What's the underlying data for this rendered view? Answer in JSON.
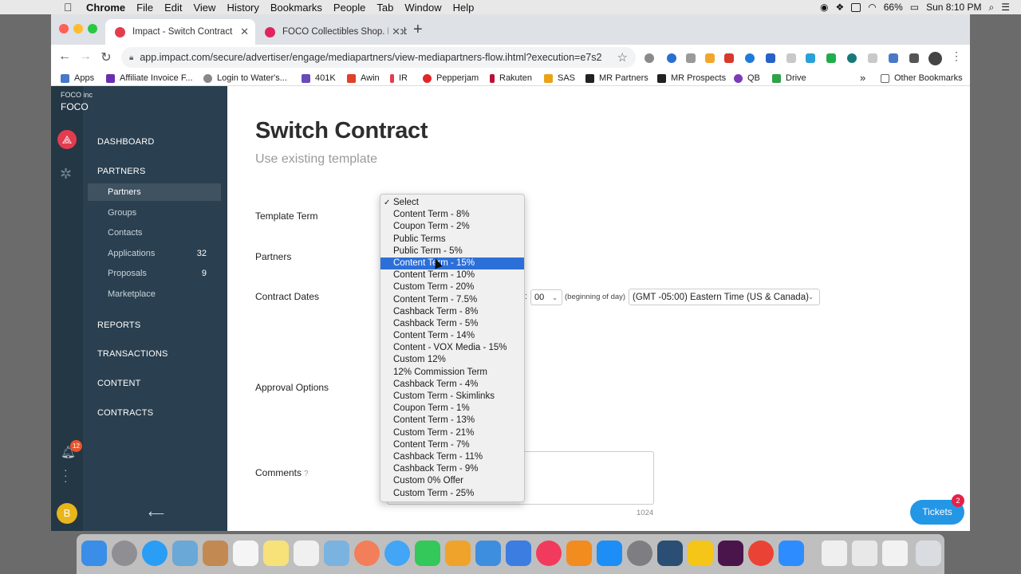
{
  "menubar": {
    "app": "Chrome",
    "items": [
      "File",
      "Edit",
      "View",
      "History",
      "Bookmarks",
      "People",
      "Tab",
      "Window",
      "Help"
    ],
    "battery": "66%",
    "clock": "Sun 8:10 PM"
  },
  "tabs": [
    {
      "title": "Impact - Switch Contract",
      "active": true
    },
    {
      "title": "FOCO Collectibles Shop. Bobb",
      "active": false
    }
  ],
  "address": {
    "url": "app.impact.com/secure/advertiser/engage/mediapartners/view-mediapartners-flow.ihtml?execution=e7s2"
  },
  "bookmarks": {
    "items": [
      "Apps",
      "Affiliate Invoice F...",
      "Login to Water's...",
      "401K",
      "Awin",
      "IR",
      "Pepperjam",
      "Rakuten",
      "SAS",
      "MR Partners",
      "MR Prospects",
      "QB",
      "Drive"
    ],
    "overflow": "»",
    "other": "Other Bookmarks"
  },
  "sidebar": {
    "org_small": "FOCO inc",
    "org_name": "FOCO",
    "dashboard": "DASHBOARD",
    "partners": "PARTNERS",
    "partners_items": [
      {
        "label": "Partners",
        "count": ""
      },
      {
        "label": "Groups",
        "count": ""
      },
      {
        "label": "Contacts",
        "count": ""
      },
      {
        "label": "Applications",
        "count": "32"
      },
      {
        "label": "Proposals",
        "count": "9"
      },
      {
        "label": "Marketplace",
        "count": ""
      }
    ],
    "reports": "REPORTS",
    "transactions": "TRANSACTIONS",
    "content": "CONTENT",
    "contracts": "CONTRACTS",
    "notification_count": "12",
    "avatar_letter": "B",
    "collapse_icon": "⟵"
  },
  "main": {
    "title": "Switch Contract",
    "subtitle": "Use existing template",
    "labels": {
      "template_term": "Template Term",
      "partners": "Partners",
      "contract_dates": "Contract Dates",
      "approval_options": "Approval Options",
      "comments": "Comments"
    },
    "time_value": "00",
    "time_note": "(beginning of day)",
    "timezone": "(GMT -05:00) Eastern Time (US & Canada)",
    "char_limit": "1024"
  },
  "dropdown": {
    "selected": "Select",
    "highlighted": "Content Term - 15%",
    "options": [
      "Select",
      "Content Term - 8%",
      "Coupon Term - 2%",
      "Public Terms",
      "Public Term - 5%",
      "Content Term - 15%",
      "Content Term - 10%",
      "Custom Term - 20%",
      "Content Term - 7.5%",
      "Cashback Term - 8%",
      "Cashback Term - 5%",
      "Content Term - 14%",
      "Content - VOX Media - 15%",
      "Custom 12%",
      "12% Commission Term",
      "Cashback Term - 4%",
      "Custom Term - Skimlinks",
      "Coupon Term - 1%",
      "Content Term - 13%",
      "Custom Term - 21%",
      "Content Term - 7%",
      "Cashback Term - 11%",
      "Cashback Term - 9%",
      "Custom 0% Offer",
      "Custom Term - 25%"
    ]
  },
  "tickets": {
    "label": "Tickets",
    "count": "2"
  },
  "icons": {
    "apple": "apple-icon",
    "back": "back-arrow-icon",
    "forward": "forward-arrow-icon",
    "reload": "reload-icon",
    "lock": "lock-icon",
    "bookmark_star": "star-icon",
    "bell": "bell-icon",
    "help": "help-icon"
  }
}
